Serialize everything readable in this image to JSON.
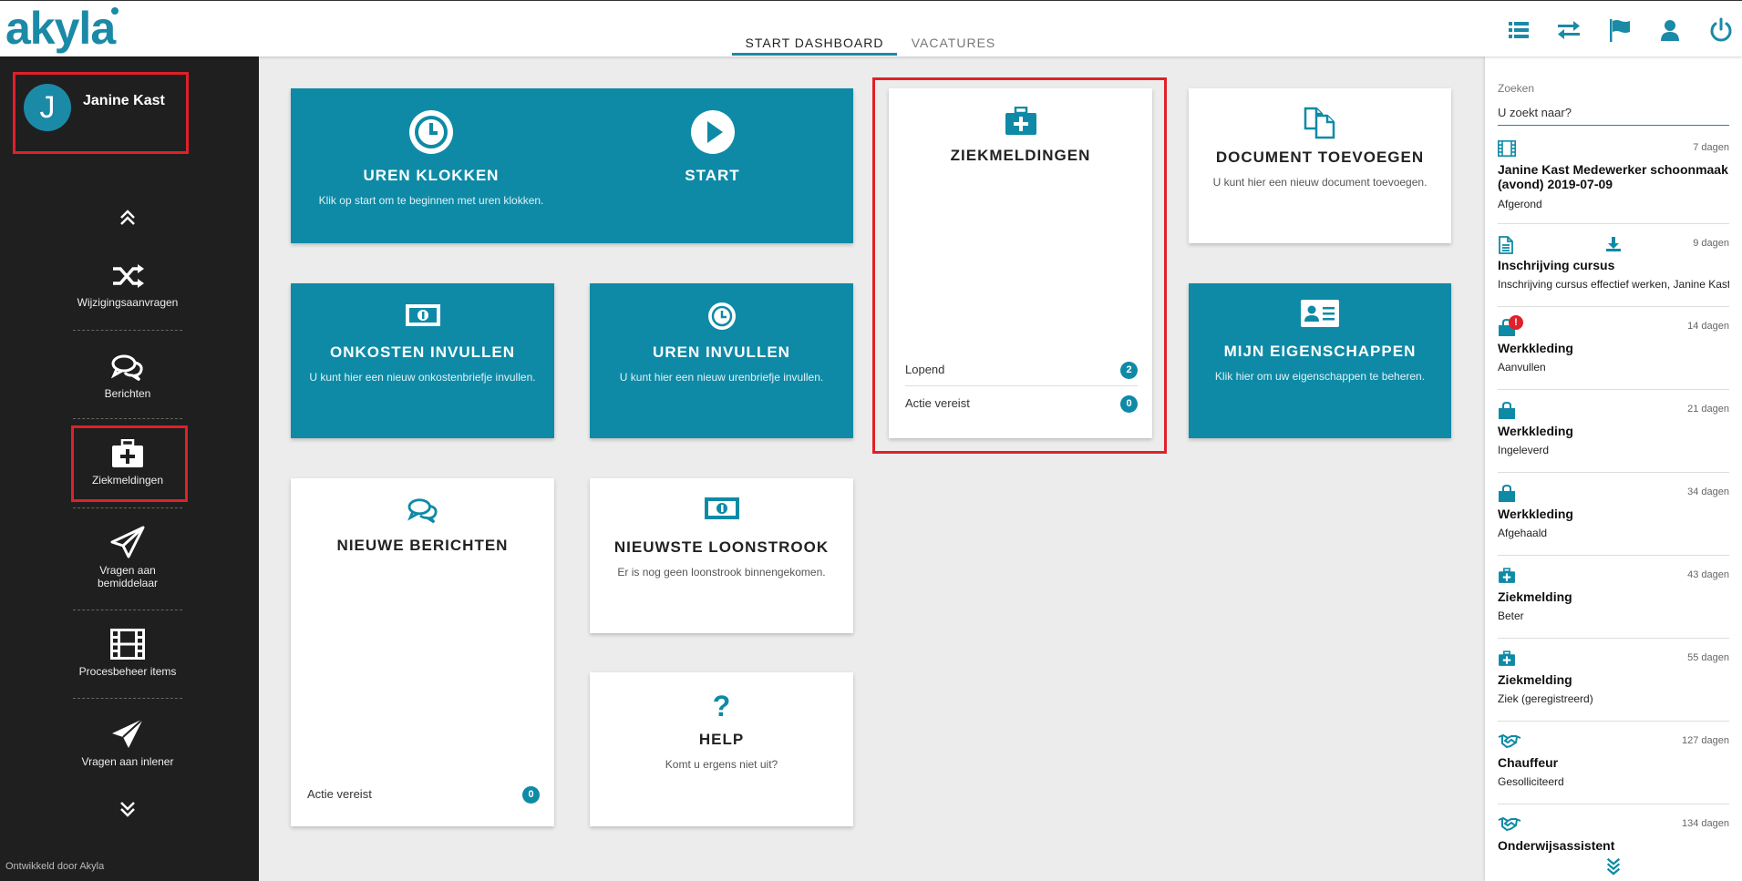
{
  "header": {
    "logo": "akyla",
    "tabs": [
      {
        "label": "START DASHBOARD"
      },
      {
        "label": "VACATURES"
      }
    ],
    "icons": [
      "list-icon",
      "swap-icon",
      "flag-icon",
      "user-icon",
      "power-icon"
    ]
  },
  "sidebar": {
    "user": {
      "initial": "J",
      "name": "Janine Kast"
    },
    "items": [
      {
        "label": "Wijzigingsaanvragen",
        "icon": "shuffle-icon"
      },
      {
        "label": "Berichten",
        "icon": "chat-icon"
      },
      {
        "label": "Ziekmeldingen",
        "icon": "medkit-icon"
      },
      {
        "label": "Vragen aan bemiddelaar",
        "icon": "paper-plane-outline-icon"
      },
      {
        "label": "Procesbeheer items",
        "icon": "film-icon"
      },
      {
        "label": "Vragen aan inlener",
        "icon": "paper-plane-icon"
      }
    ],
    "footer": "Ontwikkeld door Akyla"
  },
  "tiles": {
    "uren_klokken": {
      "title": "UREN KLOKKEN",
      "desc": "Klik op start om te beginnen met uren klokken."
    },
    "start": {
      "title": "START"
    },
    "ziekmeldingen": {
      "title": "ZIEKMELDINGEN",
      "rows": [
        {
          "label": "Lopend",
          "count": "2"
        },
        {
          "label": "Actie vereist",
          "count": "0"
        }
      ]
    },
    "document": {
      "title": "DOCUMENT TOEVOEGEN",
      "desc": "U kunt hier een nieuw document toevoegen."
    },
    "onkosten": {
      "title": "ONKOSTEN INVULLEN",
      "desc": "U kunt hier een nieuw onkostenbriefje invullen."
    },
    "uren_invullen": {
      "title": "UREN INVULLEN",
      "desc": "U kunt hier een nieuw urenbriefje invullen."
    },
    "eigenschappen": {
      "title": "MIJN EIGENSCHAPPEN",
      "desc": "Klik hier om uw eigenschappen te beheren."
    },
    "berichten": {
      "title": "NIEUWE BERICHTEN",
      "row": {
        "label": "Actie vereist",
        "count": "0"
      }
    },
    "loonstrook": {
      "title": "NIEUWSTE LOONSTROOK",
      "desc": "Er is nog geen loonstrook binnengekomen."
    },
    "help": {
      "title": "HELP",
      "desc": "Komt u ergens niet uit?"
    }
  },
  "right_panel": {
    "search": {
      "label": "Zoeken",
      "placeholder": "U zoekt naar?"
    },
    "items": [
      {
        "icon": "film-icon",
        "age": "7 dagen",
        "title": "Janine Kast Medewerker schoonmaak (avond) 2019-07-09",
        "subtitle": "Afgerond"
      },
      {
        "icon": "document-icon",
        "age": "9 dagen",
        "title": "Inschrijving cursus",
        "subtitle": "Inschrijving cursus effectief werken, Janine Kast"
      },
      {
        "icon": "shopping-bag-icon",
        "age": "14 dagen",
        "title": "Werkkleding",
        "subtitle": "Aanvullen",
        "alert": "!"
      },
      {
        "icon": "shopping-bag-icon",
        "age": "21 dagen",
        "title": "Werkkleding",
        "subtitle": "Ingeleverd"
      },
      {
        "icon": "shopping-bag-icon",
        "age": "34 dagen",
        "title": "Werkkleding",
        "subtitle": "Afgehaald"
      },
      {
        "icon": "medkit-icon",
        "age": "43 dagen",
        "title": "Ziekmelding",
        "subtitle": "Beter"
      },
      {
        "icon": "medkit-icon",
        "age": "55 dagen",
        "title": "Ziekmelding",
        "subtitle": "Ziek (geregistreerd)"
      },
      {
        "icon": "handshake-icon",
        "age": "127 dagen",
        "title": "Chauffeur",
        "subtitle": "Gesolliciteerd"
      },
      {
        "icon": "handshake-icon",
        "age": "134 dagen",
        "title": "Onderwijsassistent",
        "subtitle": ""
      }
    ]
  },
  "colors": {
    "accent": "#0e8aa6",
    "sidebar": "#1f1f1f",
    "highlight": "#e0202a"
  }
}
